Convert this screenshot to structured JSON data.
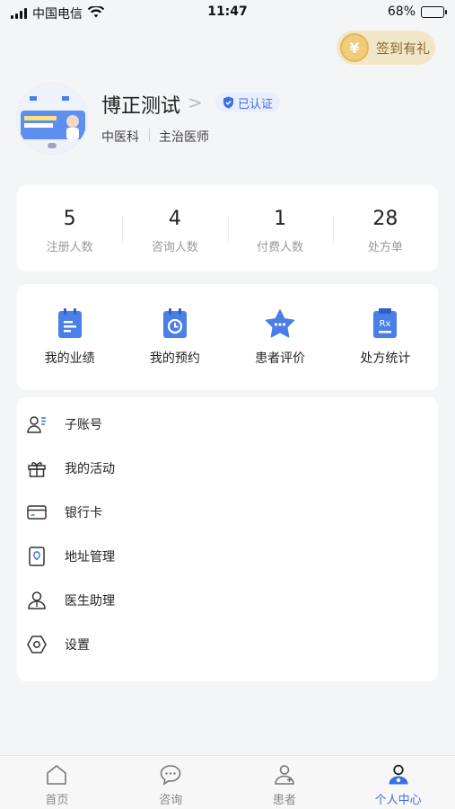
{
  "status_bar": {
    "carrier": "中国电信",
    "time": "11:47",
    "battery_level": "68%",
    "battery_fraction": 0.68
  },
  "signin": {
    "coin_symbol": "¥",
    "label": "签到有礼"
  },
  "profile": {
    "name": "博正测试",
    "verified_label": "已认证",
    "department": "中医科",
    "title": "主治医师",
    "avatar_icon": "doctor-banner-avatar"
  },
  "stats": [
    {
      "value": "5",
      "label": "注册人数"
    },
    {
      "value": "4",
      "label": "咨询人数"
    },
    {
      "value": "1",
      "label": "付费人数"
    },
    {
      "value": "28",
      "label": "处方单"
    }
  ],
  "quick_actions": [
    {
      "label": "我的业绩",
      "icon": "performance-icon"
    },
    {
      "label": "我的预约",
      "icon": "appointment-icon"
    },
    {
      "label": "患者评价",
      "icon": "review-star-icon"
    },
    {
      "label": "处方统计",
      "icon": "prescription-rx-icon",
      "icon_text": "Rx"
    }
  ],
  "menu": [
    {
      "label": "子账号",
      "icon": "sub-account-icon"
    },
    {
      "label": "我的活动",
      "icon": "gift-icon"
    },
    {
      "label": "银行卡",
      "icon": "bank-card-icon"
    },
    {
      "label": "地址管理",
      "icon": "address-book-icon"
    },
    {
      "label": "医生助理",
      "icon": "assistant-icon"
    },
    {
      "label": "设置",
      "icon": "settings-hexagon-icon"
    }
  ],
  "tabs": [
    {
      "label": "首页",
      "icon": "home-icon",
      "active": false
    },
    {
      "label": "咨询",
      "icon": "chat-bubble-icon",
      "active": false
    },
    {
      "label": "患者",
      "icon": "patient-icon",
      "active": false
    },
    {
      "label": "个人中心",
      "icon": "profile-icon",
      "active": true
    }
  ],
  "colors": {
    "accent": "#3d6fe0",
    "icon_blue": "#4a7fe8",
    "gold": "#f0cd7a",
    "background": "#f4f5f7"
  }
}
